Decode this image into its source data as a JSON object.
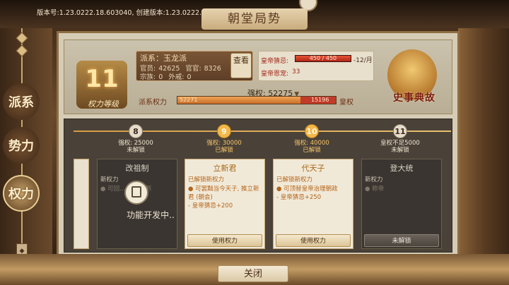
{
  "version_text": "版本号:1.23.0222.18.603040, 创建版本:1.23.0222.18, 档位:本地档位",
  "title": "朝堂局势",
  "side_tabs": [
    "派系",
    "势力",
    "权力"
  ],
  "power_level": {
    "number": "11",
    "label": "权力等级"
  },
  "faction": {
    "name_label": "派系：玉龙派",
    "officials_label": "官员:",
    "officials": "42625",
    "rank_label": "官官:",
    "rank": "8326",
    "clan_label": "宗族:",
    "clan": "0",
    "external_label": "外戚:",
    "external": "0",
    "view_button": "查看"
  },
  "emperor": {
    "suspicion_label": "皇帝猜忌:",
    "suspicion_value": "450 / 450",
    "suspicion_fraction": 1.0,
    "rate": "-12/月",
    "favor_label": "皇帝恩宠:",
    "favor_value": "33"
  },
  "history_label": "史事典故",
  "power": {
    "label": "强权: 52275",
    "faction_power_label": "派系权力",
    "faction_value": "52271",
    "imperial_value": "15196",
    "faction_fraction": 0.775,
    "imperial_label": "皇权"
  },
  "nodes": [
    {
      "num": "8",
      "req": "强权: 25000",
      "status": "未解锁",
      "state": "locked"
    },
    {
      "num": "9",
      "req": "强权: 30000",
      "status": "已解锁",
      "state": "unlocked"
    },
    {
      "num": "10",
      "req": "强权: 40000",
      "status": "已解锁",
      "state": "unlocked"
    },
    {
      "num": "11",
      "req": "皇权不足5000",
      "status": "未解锁",
      "state": "locked"
    }
  ],
  "cards": [
    {
      "title": "改祖制",
      "head": "新权力",
      "body": "● 可回... 祖制条例",
      "button": ""
    },
    {
      "title": "立新君",
      "head": "已解锁新权力",
      "body": "● 可罢黜当今天子, 推立新君 (朝会)\n- 皇帝猜忌+200",
      "button": "使用权力"
    },
    {
      "title": "代天子",
      "head": "已解锁新权力",
      "body": "● 可顶替皇帝治理朝政\n- 皇帝猜忌+250",
      "button": "使用权力"
    },
    {
      "title": "登大统",
      "head": "新权力",
      "body": "● 称帝",
      "button": "未解锁"
    }
  ],
  "dev_text": "功能开发中..",
  "close_button": "关闭"
}
